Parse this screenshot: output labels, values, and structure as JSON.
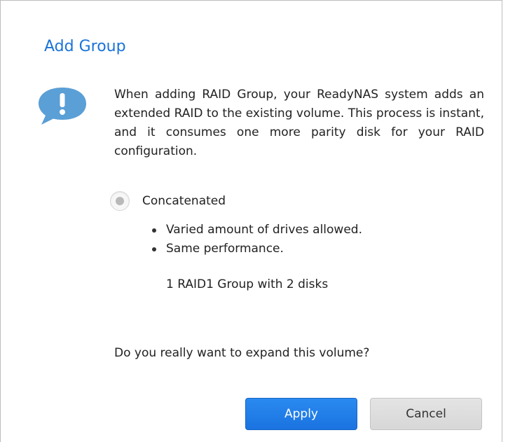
{
  "dialog": {
    "title": "Add Group",
    "icon": "info-speech-bubble-icon",
    "message": "When adding RAID Group, your ReadyNAS system adds an extended RAID to the existing volume. This process is instant, and it consumes one more parity disk for your RAID configuration.",
    "option": {
      "label": "Concatenated",
      "selected": true,
      "bullets": [
        "Varied amount of drives allowed.",
        "Same performance."
      ],
      "group_info": "1 RAID1 Group with 2 disks"
    },
    "confirm_text": "Do you really want to expand this volume?",
    "buttons": {
      "apply": "Apply",
      "cancel": "Cancel"
    },
    "colors": {
      "title": "#1a73d9",
      "icon": "#5a9fd6",
      "apply_bg": "#1a73e0",
      "cancel_bg": "#dcdcdc"
    }
  }
}
